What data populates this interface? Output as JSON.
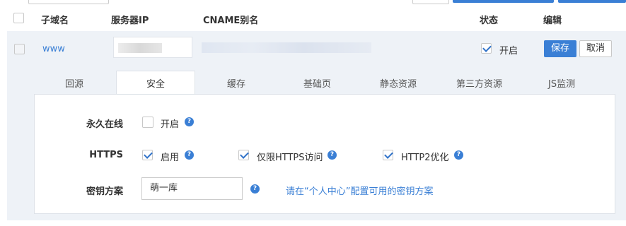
{
  "table": {
    "headers": {
      "subdomain": "子域名",
      "server_ip": "服务器IP",
      "cname": "CNAME别名",
      "status": "状态",
      "edit": "编辑"
    },
    "row": {
      "subdomain": "www",
      "status_label": "开启",
      "status_checked": true,
      "save_label": "保存",
      "cancel_label": "取消"
    }
  },
  "tabs": [
    {
      "label": "回源",
      "active": false
    },
    {
      "label": "安全",
      "active": true
    },
    {
      "label": "缓存",
      "active": false
    },
    {
      "label": "基础页",
      "active": false
    },
    {
      "label": "静态资源",
      "active": false
    },
    {
      "label": "第三方资源",
      "active": false
    },
    {
      "label": "JS监测",
      "active": false
    }
  ],
  "security": {
    "always_online": {
      "label": "永久在线",
      "option_label": "开启",
      "checked": false
    },
    "https": {
      "label": "HTTPS",
      "enable_label": "启用",
      "enable_checked": true,
      "https_only_label": "仅限HTTPS访问",
      "https_only_checked": true,
      "http2_label": "HTTP2优化",
      "http2_checked": true
    },
    "key_scheme": {
      "label": "密钥方案",
      "value": "萌一库",
      "hint": "请在“个人中心”配置可用的密钥方案"
    }
  },
  "icons": {
    "help": "?"
  },
  "colors": {
    "accent": "#3a7fd5",
    "region_bg": "#eef2f7"
  }
}
